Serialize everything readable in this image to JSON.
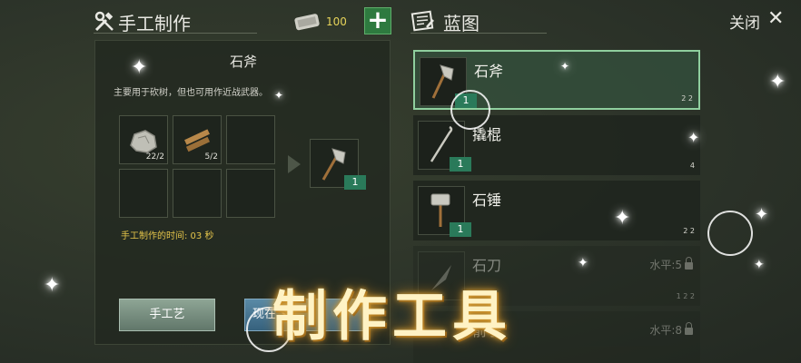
{
  "header": {
    "craft_title": "手工制作",
    "gold_amount": "100",
    "plus_label": "+",
    "blueprint_title": "蓝图",
    "close_label": "关闭",
    "close_symbol": "✕"
  },
  "detail": {
    "item_name": "石斧",
    "description": "主要用于砍树，但也可用作近战武器。",
    "ingredients": [
      {
        "icon": "stone-icon",
        "count": "22/2"
      },
      {
        "icon": "stick-icon",
        "count": "5/2"
      }
    ],
    "output_qty": "1",
    "craft_time": "手工制作的时间:  03 秒",
    "button_craft": "手工艺",
    "button_now": "现在"
  },
  "blueprints": [
    {
      "name": "石斧",
      "qty": "1",
      "req": "2   2",
      "selected": true
    },
    {
      "name": "撬棍",
      "qty": "1",
      "req": "4"
    },
    {
      "name": "石锤",
      "qty": "1",
      "req": "2   2"
    },
    {
      "name": "石刀",
      "level": "水平:5",
      "req": "1   2   2",
      "locked": true
    },
    {
      "name": "箭子",
      "level": "水平:8",
      "locked": true
    }
  ],
  "overlay_text": "制作工具",
  "colors": {
    "accent_green": "#2e7a3f",
    "selected_border": "#8fcf9e",
    "time_text": "#e4c44a"
  }
}
